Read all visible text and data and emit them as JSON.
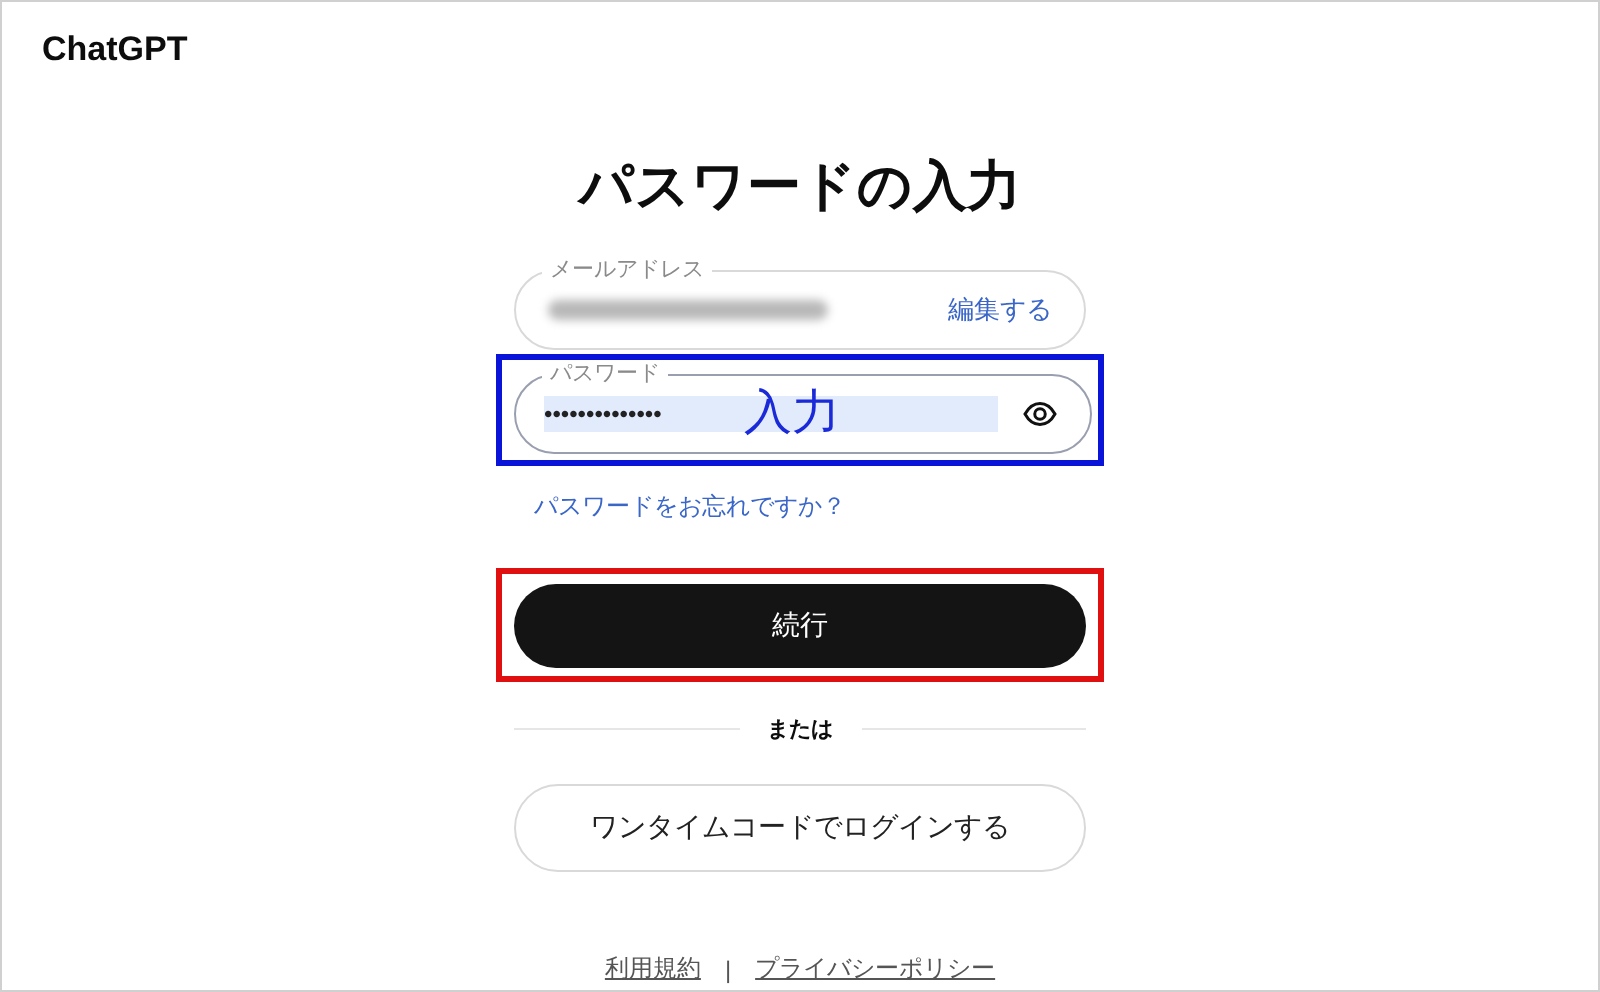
{
  "brand": "ChatGPT",
  "title": "パスワードの入力",
  "email_field": {
    "label": "メールアドレス",
    "edit_link": "編集する"
  },
  "password_field": {
    "label": "パスワード",
    "value": "••••••••••••••",
    "highlighted": true,
    "annotated": true,
    "annotation": "入力"
  },
  "forgot_link": "パスワードをお忘れですか？",
  "continue_button": {
    "label": "続行",
    "annotated": true
  },
  "divider_text": "または",
  "otp_button": {
    "label": "ワンタイムコードでログインする"
  },
  "footer": {
    "terms_link": "利用規約",
    "separator": "|",
    "privacy_link": "プライバシーポリシー"
  }
}
